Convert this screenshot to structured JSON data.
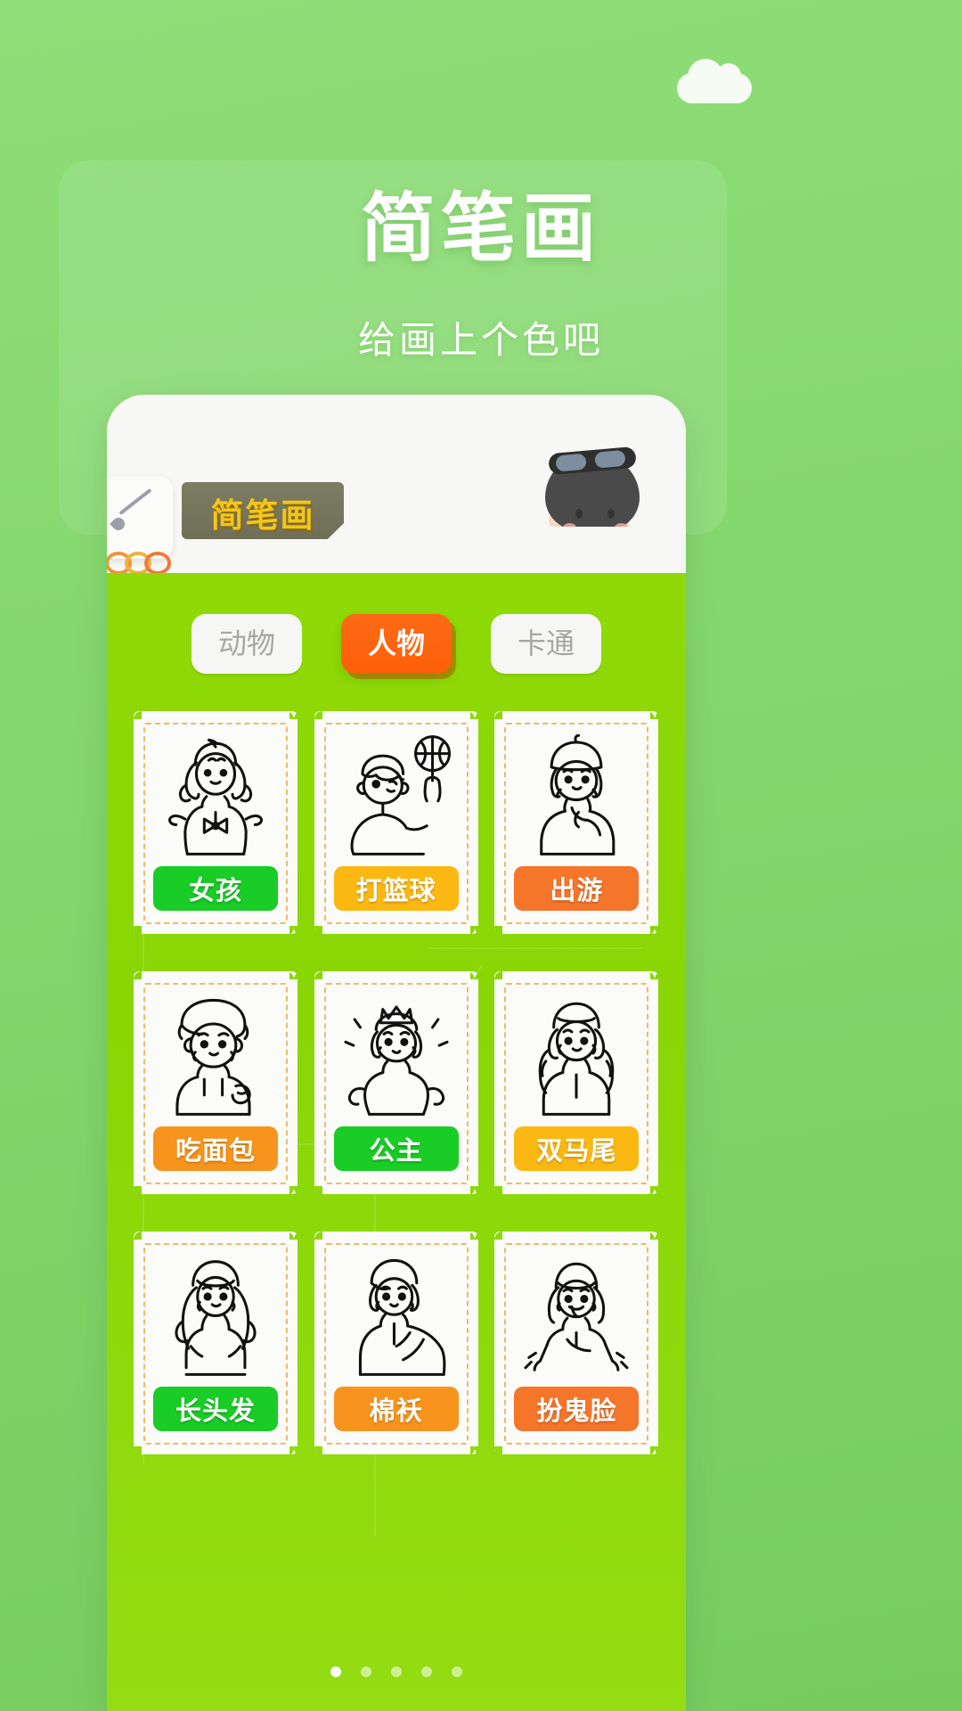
{
  "page": {
    "title": "简笔画",
    "subtitle": "给画上个色吧"
  },
  "app": {
    "ribbon_label": "简笔画",
    "brush_icon": "paint-brush-icon",
    "avatar_icon": "kid-pilot-avatar"
  },
  "tabs": [
    {
      "label": "动物",
      "active": false
    },
    {
      "label": "人物",
      "active": true
    },
    {
      "label": "卡通",
      "active": false
    }
  ],
  "cards": [
    {
      "label": "女孩",
      "color": "#19cc26",
      "art": "girl-bowtie-sketch"
    },
    {
      "label": "打篮球",
      "color": "#fbb812",
      "art": "boy-basketball-sketch"
    },
    {
      "label": "出游",
      "color": "#f5752a",
      "art": "girl-scarf-sketch"
    },
    {
      "label": "吃面包",
      "color": "#f7941d",
      "art": "girl-eating-bread-sketch"
    },
    {
      "label": "公主",
      "color": "#19cc26",
      "art": "princess-crown-sketch"
    },
    {
      "label": "双马尾",
      "color": "#fbb812",
      "art": "twin-tails-girl-sketch"
    },
    {
      "label": "长头发",
      "color": "#19cc26",
      "art": "long-hair-girl-sketch"
    },
    {
      "label": "棉袄",
      "color": "#f7941d",
      "art": "padded-coat-girl-sketch"
    },
    {
      "label": "扮鬼脸",
      "color": "#f5752a",
      "art": "funny-face-girl-sketch"
    }
  ],
  "pagination": {
    "count": 5,
    "active_index": 0
  },
  "colors": {
    "background_green": "#86d96f",
    "app_green": "#8ed907",
    "accent_orange": "#fc5f08",
    "ribbon_olive": "#6f6f58",
    "ribbon_gold": "#f5c518"
  }
}
